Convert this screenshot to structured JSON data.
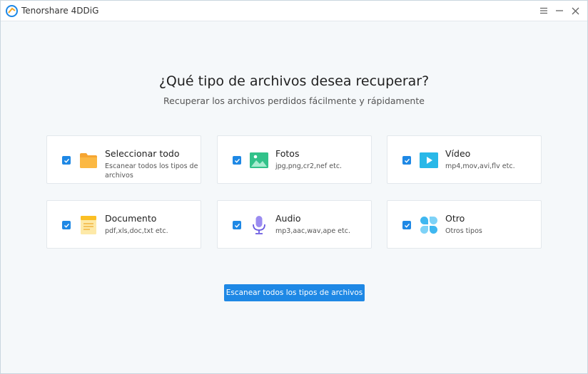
{
  "app": {
    "title": "Tenorshare 4DDiG"
  },
  "window_controls": {
    "menu_icon": "menu-icon",
    "minimize_icon": "minimize-icon",
    "close_icon": "close-icon"
  },
  "main": {
    "heading": "¿Qué tipo de archivos desea recuperar?",
    "subheading": "Recuperar los archivos perdidos fácilmente y rápidamente"
  },
  "file_types": [
    {
      "title": "Seleccionar todo",
      "desc": "Escanear todos los tipos de archivos",
      "icon": "folder-icon",
      "checked": true
    },
    {
      "title": "Fotos",
      "desc": "jpg,png,cr2,nef etc.",
      "icon": "photo-icon",
      "checked": true
    },
    {
      "title": "Vídeo",
      "desc": "mp4,mov,avi,flv etc.",
      "icon": "video-icon",
      "checked": true
    },
    {
      "title": "Documento",
      "desc": "pdf,xls,doc,txt etc.",
      "icon": "document-icon",
      "checked": true
    },
    {
      "title": "Audio",
      "desc": "mp3,aac,wav,ape etc.",
      "icon": "microphone-icon",
      "checked": true
    },
    {
      "title": "Otro",
      "desc": "Otros tipos",
      "icon": "other-files-icon",
      "checked": true
    }
  ],
  "scan_button": {
    "label": "Escanear todos los tipos de archivos"
  },
  "colors": {
    "accent": "#1e88e5",
    "background": "#f5f8fa",
    "card": "#ffffff"
  }
}
